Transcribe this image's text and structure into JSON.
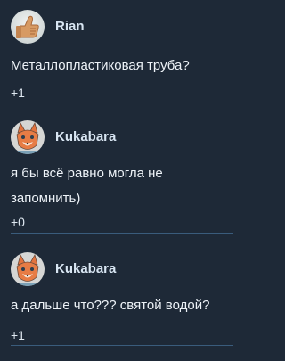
{
  "comments": [
    {
      "author": "Rian",
      "avatar_icon": "thumbs-up-avatar-icon",
      "text": "Металлопластиковая труба?",
      "votes": "+1"
    },
    {
      "author": "Kukabara",
      "avatar_icon": "fox-avatar-icon",
      "text": "я бы всё равно могла не запомнить)",
      "votes": "+0"
    },
    {
      "author": "Kukabara",
      "avatar_icon": "fox-avatar-icon",
      "text": "а дальше что??? святой водой?",
      "votes": "+1"
    }
  ],
  "colors": {
    "background": "#1e2937",
    "divider": "#3a5c7c",
    "author_text": "#d8e5f2"
  }
}
